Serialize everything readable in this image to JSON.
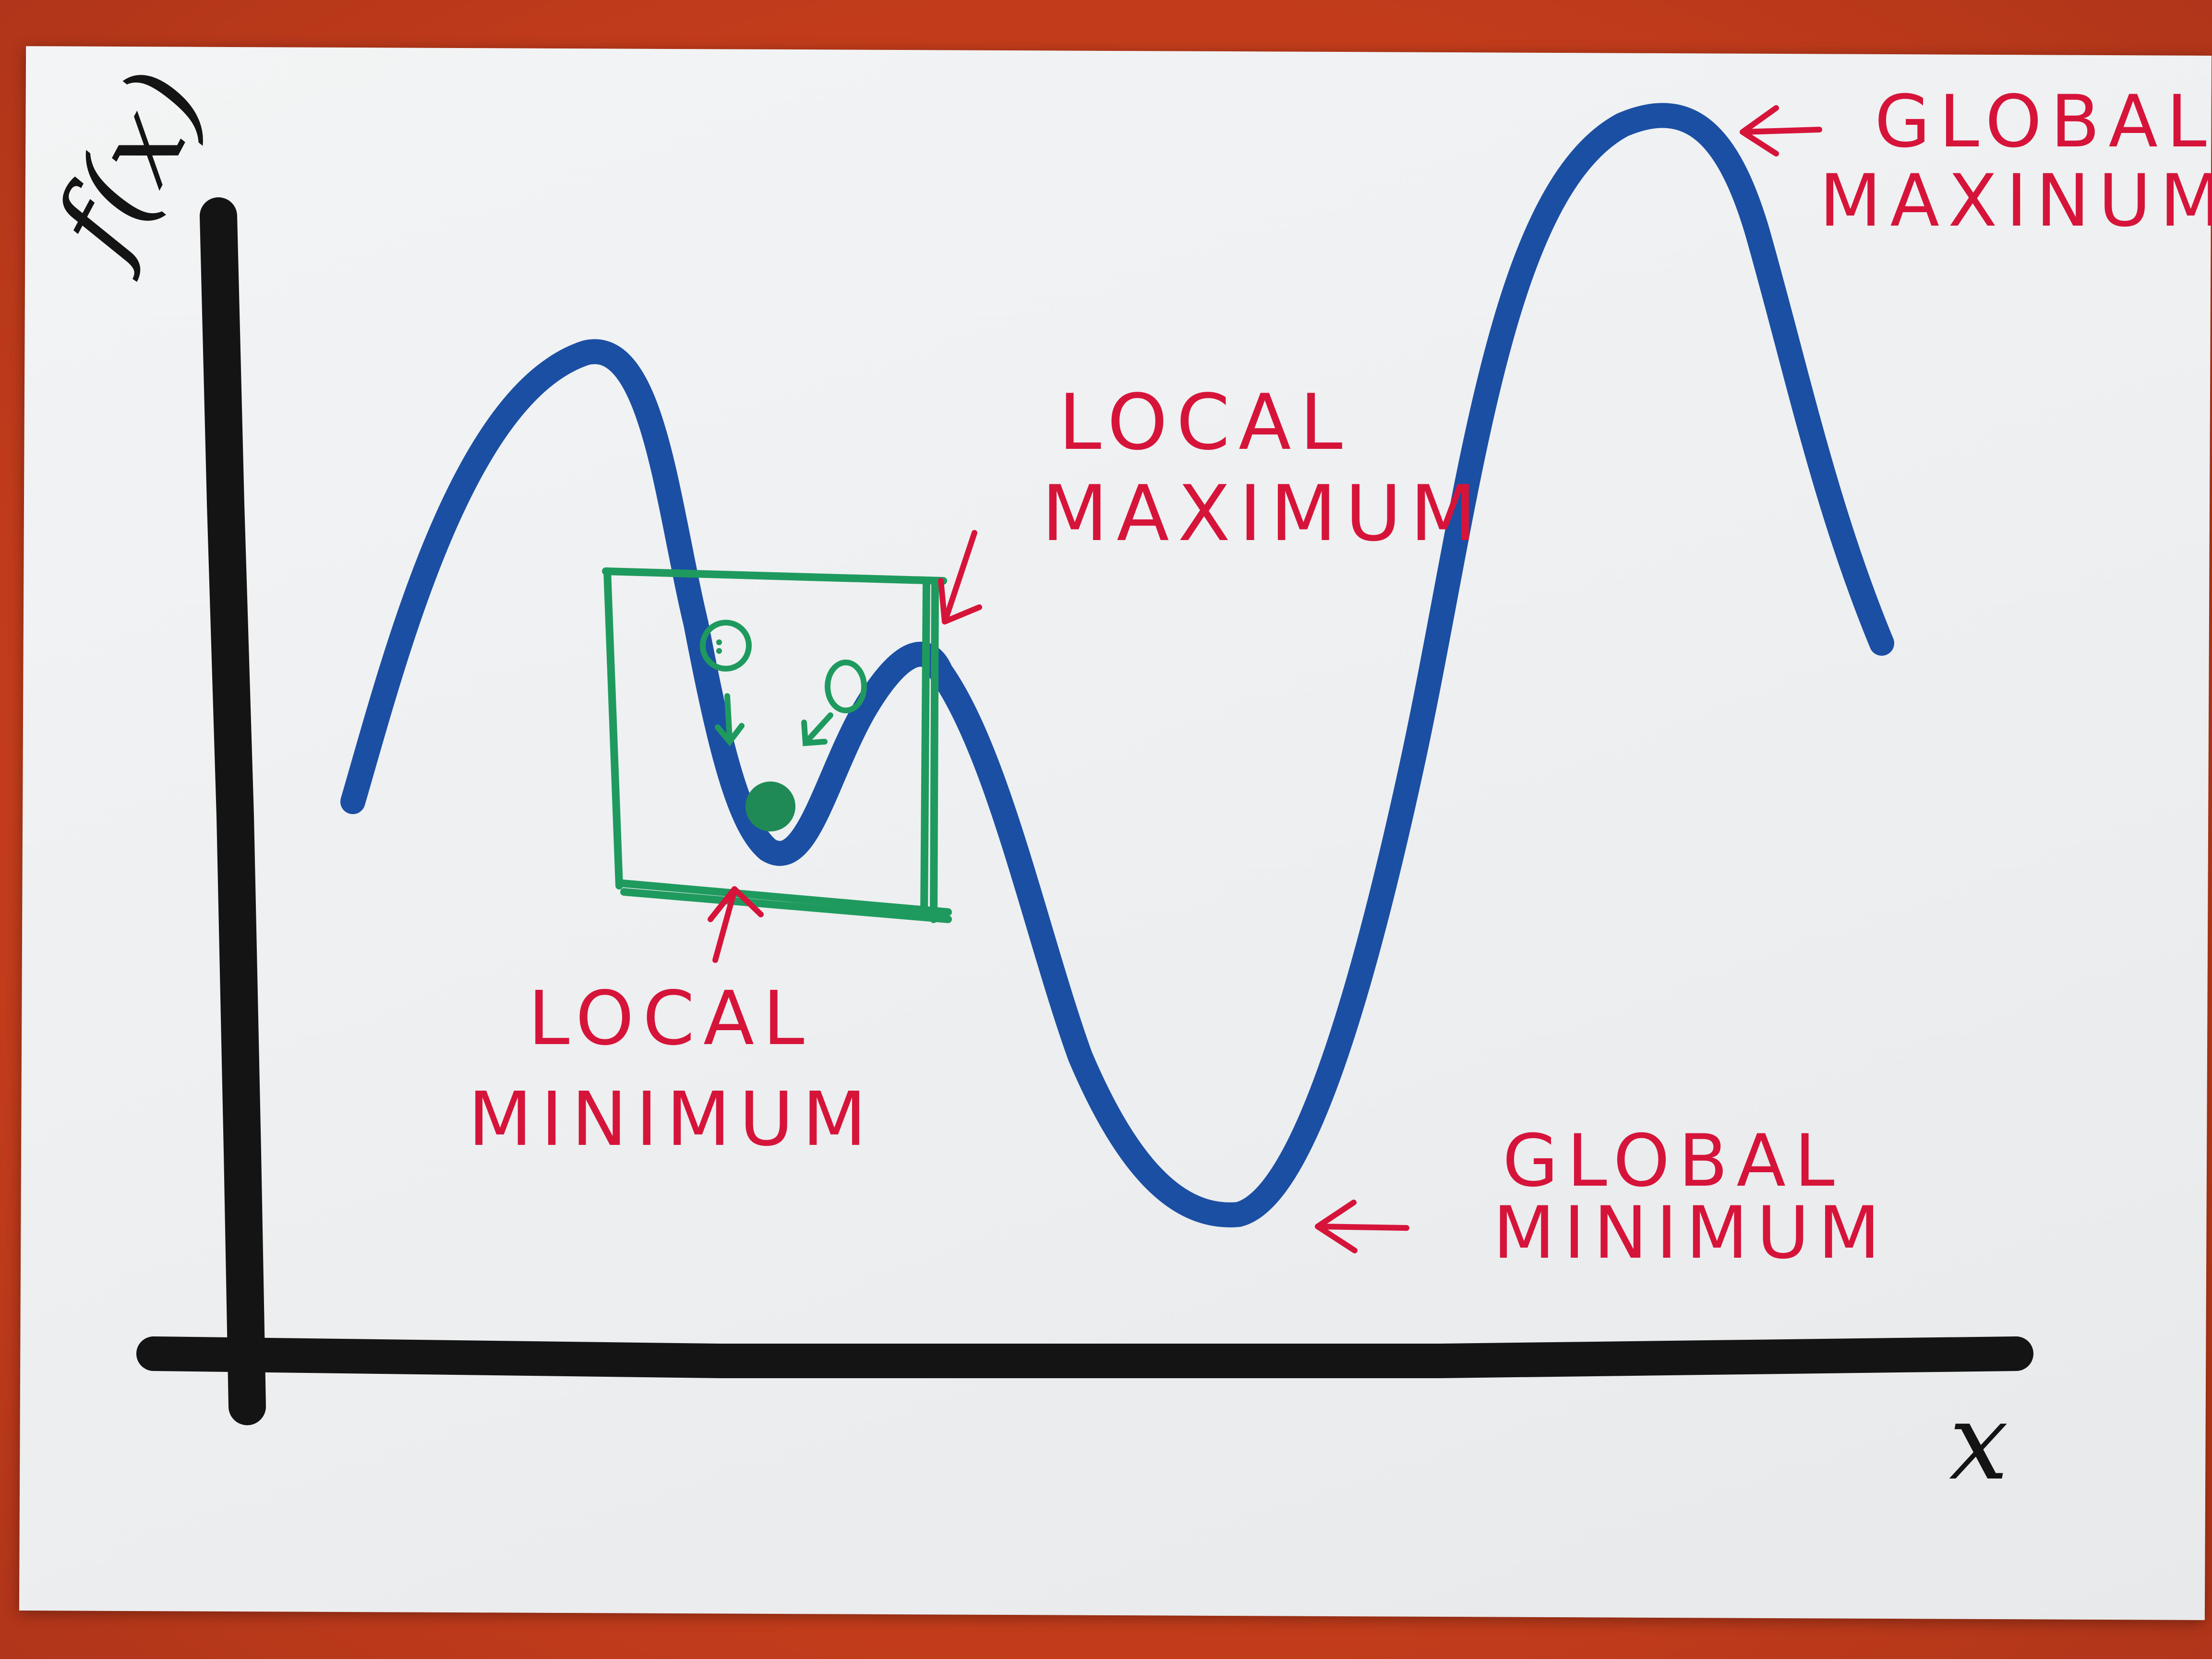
{
  "axes": {
    "y_label": "f(x)",
    "x_label": "x"
  },
  "annotations": {
    "global_maximum": [
      "GLOBAL",
      "MAXINUM"
    ],
    "local_maximum": [
      "LOCAL",
      "MAXIMUM"
    ],
    "local_minimum": [
      "LOCAL",
      "MINIMUM"
    ],
    "global_minimum": [
      "GLOBAL",
      "MINIMUM"
    ]
  },
  "colors": {
    "background_surface": "#c8421f",
    "card": "#eef0f2",
    "axes_ink": "#141414",
    "curve_ink": "#1b4fa3",
    "annotation_ink": "#d6143a",
    "highlight_ink": "#1f9a5e"
  }
}
